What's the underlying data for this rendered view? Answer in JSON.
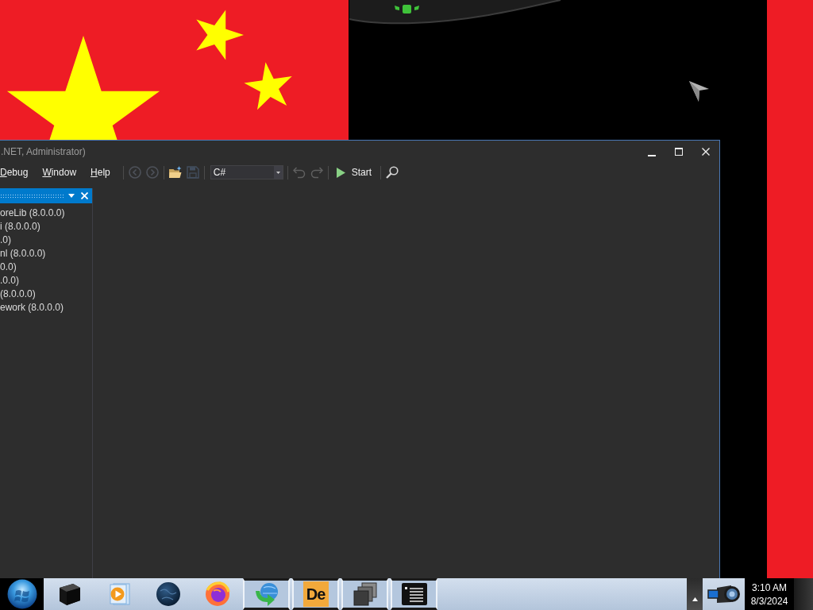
{
  "window": {
    "title": ".NET, Administrator)",
    "menu": [
      {
        "label": "Debug"
      },
      {
        "label": "Window"
      },
      {
        "label": "Help"
      }
    ],
    "toolbar_groups": [
      {
        "items": [
          {
            "kind": "back",
            "disabled": true
          },
          {
            "kind": "forward",
            "disabled": true
          }
        ]
      },
      {
        "items": [
          {
            "kind": "open",
            "disabled": false
          },
          {
            "kind": "save",
            "disabled": true
          }
        ]
      },
      {
        "items": [
          {
            "kind": "combo",
            "value": "C#",
            "disabled": false
          }
        ]
      },
      {
        "items": [
          {
            "kind": "undo",
            "disabled": true
          },
          {
            "kind": "redo",
            "disabled": true
          }
        ]
      },
      {
        "items": [
          {
            "kind": "start",
            "label": "Start",
            "disabled": false
          }
        ]
      },
      {
        "items": [
          {
            "kind": "search",
            "disabled": false
          }
        ]
      }
    ],
    "side_panel": {
      "items": [
        "oreLib (8.0.0.0)",
        "i (8.0.0.0)",
        ".0)",
        "nl (8.0.0.0)",
        "0.0)",
        ".0.0)",
        "(8.0.0.0)",
        "ework (8.0.0.0)"
      ]
    }
  },
  "taskbar": {
    "apps": [
      {
        "kind": "box",
        "running": false
      },
      {
        "kind": "media",
        "running": false
      },
      {
        "kind": "globe",
        "running": false
      },
      {
        "kind": "swirl",
        "running": false
      },
      {
        "kind": "globe-arrow",
        "running": true
      },
      {
        "kind": "tile",
        "label": "De",
        "running": true
      },
      {
        "kind": "stack",
        "running": true
      },
      {
        "kind": "list",
        "running": true
      }
    ],
    "clock": {
      "time": "3:10 AM",
      "date": "8/3/2024"
    }
  }
}
